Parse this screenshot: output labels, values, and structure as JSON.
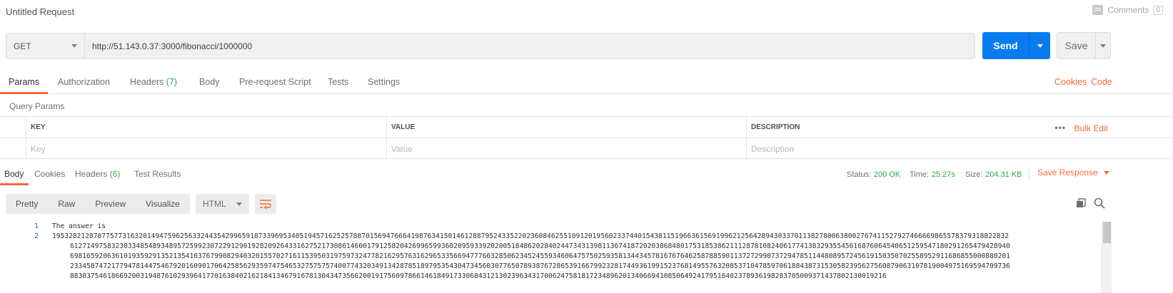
{
  "header": {
    "title": "Untitled Request",
    "comments_label": "Comments",
    "comments_count": "0"
  },
  "request": {
    "method": "GET",
    "url": "http://51.143.0.37:3000/fibonacci/1000000",
    "send_label": "Send",
    "save_label": "Save"
  },
  "request_tabs": {
    "params": "Params",
    "authorization": "Authorization",
    "headers": "Headers",
    "headers_count": "(7)",
    "body": "Body",
    "prerequest": "Pre-request Script",
    "tests": "Tests",
    "settings": "Settings",
    "cookies_link": "Cookies",
    "code_link": "Code"
  },
  "query_params": {
    "title": "Query Params",
    "columns": [
      "KEY",
      "VALUE",
      "DESCRIPTION"
    ],
    "placeholders": [
      "Key",
      "Value",
      "Description"
    ],
    "bulk_edit": "Bulk Edit",
    "more": "•••"
  },
  "response_tabs": {
    "body": "Body",
    "cookies": "Cookies",
    "headers": "Headers",
    "headers_count": "(6)",
    "test_results": "Test Results"
  },
  "response_meta": {
    "status_label": "Status:",
    "status_value": "200 OK",
    "time_label": "Time:",
    "time_value": "25.27s",
    "size_label": "Size:",
    "size_value": "204.31 KB",
    "save_response": "Save Response"
  },
  "format_bar": {
    "pretty": "Pretty",
    "raw": "Raw",
    "preview": "Preview",
    "visualize": "Visualize",
    "language": "HTML"
  },
  "code": {
    "line_numbers": [
      "1",
      "2"
    ],
    "line1": "The answer is",
    "line2": "1953282128707757731632014947596256332443542996591873396953405194571625257887015694766641987634150146128879524335220236084625510912019560233744015438115196636156919962125642894303370113827800638002767411527927466669865578379318822832",
    "wrap1": "612714975832303348548934895725992307229129019282092643316275217308614600179125820426996599360209593392020051848620284024473431398113674187202038684801753185386211128781082406177413832935545616876064540651259547180291265479428940",
    "wrap2": "698165920636101935929135213541037679908294032015570271611539503197597324778216295763162965335669477766328506234524559346064757502593581344345781676764625878859011372729907372947851144808957245619150350702558952911686855000880201",
    "wrap3": "233458747217794781447546792016090170642585629359747546532757575740077432034913428785189795354304734560307765078938767286539166799232817449361991523768149557632085371047859706188438731530582395627560879063107819004975169594709736",
    "wrap4": "883037546186692003194876102939641770163840216218413467916781304347356620019175609786614618491733068431213023963431700624758181723489620134066941085064924179516402378936198283705009371437802130019216"
  }
}
